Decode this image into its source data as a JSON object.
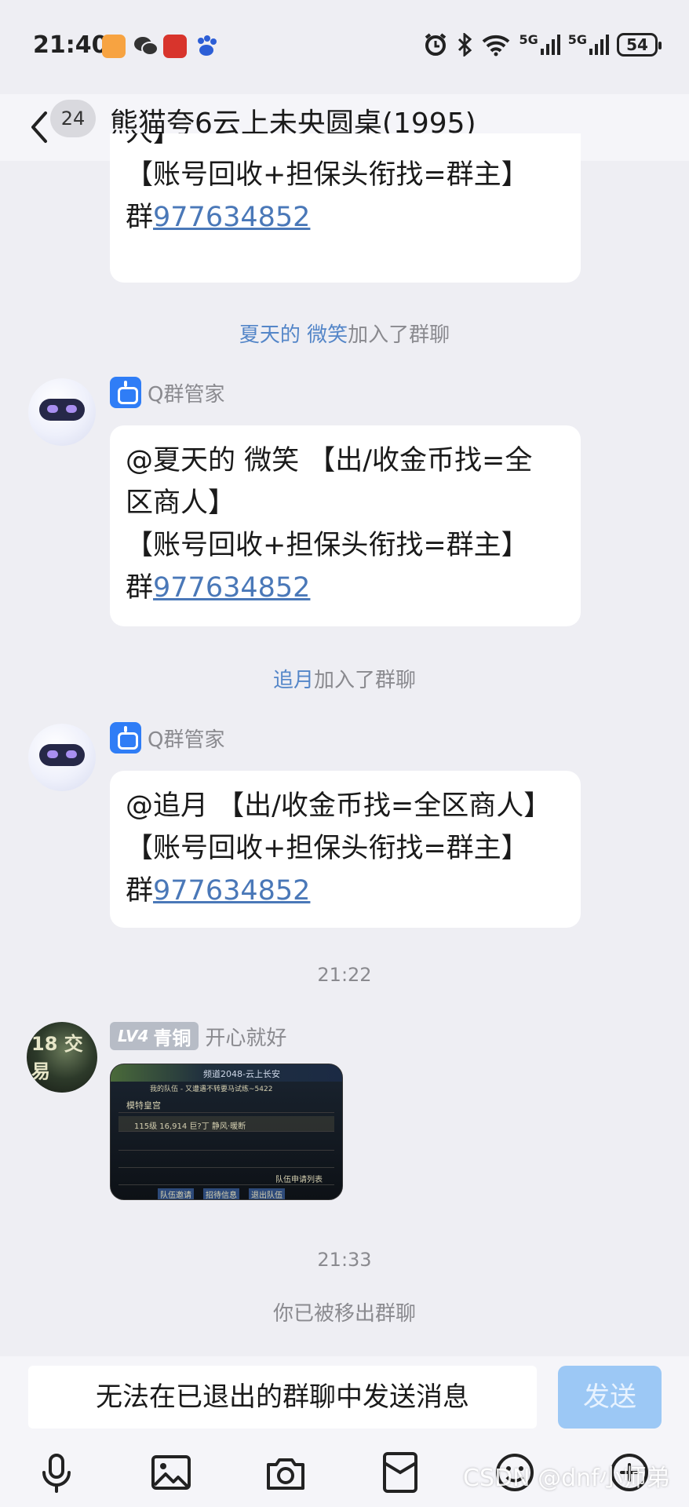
{
  "status_bar": {
    "time": "21:40",
    "battery": "54",
    "signal1": "5G",
    "signal2": "5G"
  },
  "header": {
    "unread_count": "24",
    "title": "熊猫夸6云上未央圆桌(1995)"
  },
  "messages": {
    "partial_bubble": {
      "line1": "人】",
      "line2": "【账号回收+担保头衔找=群主】",
      "line3_prefix": "群",
      "line3_link": "977634852"
    },
    "join1": {
      "name": "夏天的 微笑",
      "suffix": "加入了群聊"
    },
    "bot1": {
      "sender": "Q群管家",
      "line1": "@夏天的 微笑 【出/收金币找=全",
      "line2": "区商人】",
      "line3": "【账号回收+担保头衔找=群主】",
      "line4_prefix": "群",
      "line4_link": "977634852"
    },
    "join2": {
      "name": "追月",
      "suffix": "加入了群聊"
    },
    "bot2": {
      "sender": "Q群管家",
      "line1": "@追月 【出/收金币找=全区商人】",
      "line2": "【账号回收+担保头衔找=群主】",
      "line3_prefix": "群",
      "line3_link": "977634852"
    },
    "time1": "21:22",
    "user_msg": {
      "level": "LV4",
      "rank": "青铜",
      "sender": "开心就好",
      "avatar_text": "18 交易",
      "image_texts": {
        "top": "频道2048-云上长安",
        "row1": "我的队伍 - 又遭遇不转要马试练~5422",
        "row2": "模特皇宫",
        "row3": "115级  16,914   巨?丁   静风·暖断",
        "bottom": "队伍申请列表",
        "btn1": "队伍邀请",
        "btn2": "招待信息",
        "btn3": "退出队伍"
      }
    },
    "time2": "21:33",
    "removed": "你已被移出群聊"
  },
  "input": {
    "placeholder": "无法在已退出的群聊中发送消息",
    "send_label": "发送"
  },
  "watermark": "CSDN @dnf小师弟"
}
